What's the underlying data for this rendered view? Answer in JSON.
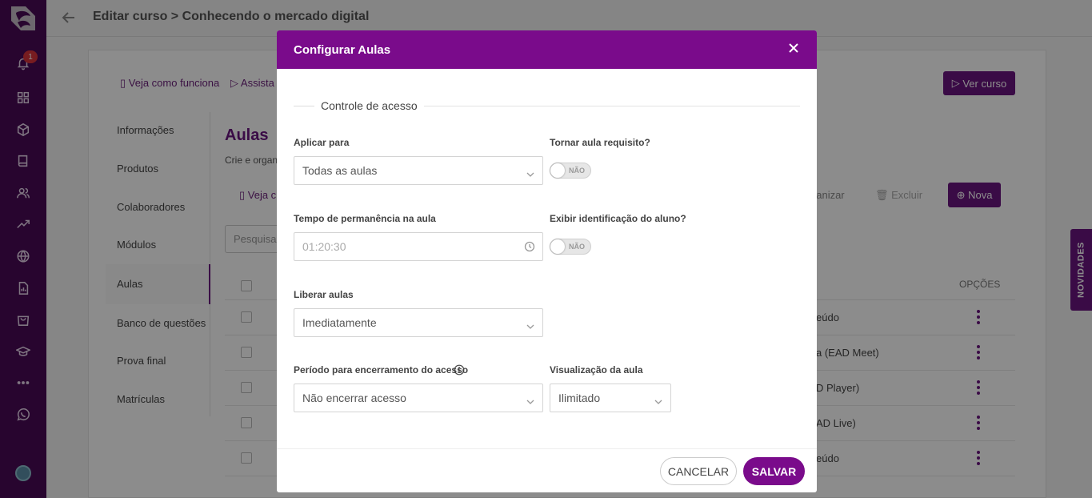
{
  "app": {
    "notification_count": "1"
  },
  "topbar": {
    "title": "Editar curso > Conhecendo o mercado digital"
  },
  "background": {
    "link_how_it_works": "Veja como funciona",
    "link_watch": "Assista",
    "ver_curso": "Ver curso",
    "subnav": [
      "Informações",
      "Produtos",
      "Colaboradores",
      "Módulos",
      "Aulas",
      "Banco de questões",
      "Prova final",
      "Matrículas"
    ],
    "aulas_title": "Aulas",
    "aulas_sub": "Crie e organ",
    "veja_link": "Veja c",
    "organizar": "ganizar",
    "excluir": "Excluir",
    "nova": "Nova",
    "search_placeholder": "Pesquisa",
    "opcoes": "OPÇÕES",
    "rows": [
      "eúdo",
      "a (EAD Meet)",
      "D Player)",
      "AD Live)",
      "eúdo"
    ],
    "novidades": "NOVIDADES"
  },
  "modal": {
    "title": "Configurar Aulas",
    "section": "Controle de acesso",
    "aplicar_para": {
      "label": "Aplicar para",
      "value": "Todas as aulas"
    },
    "tornar_requisito": {
      "label": "Tornar aula requisito?",
      "state": "NÃO"
    },
    "tempo_permanencia": {
      "label": "Tempo de permanência na aula",
      "placeholder": "01:20:30"
    },
    "exibir_identificacao": {
      "label": "Exibir identificação do aluno?",
      "state": "NÃO"
    },
    "liberar_aulas": {
      "label": "Liberar aulas",
      "value": "Imediatamente"
    },
    "periodo_encerramento": {
      "label": "Período para encerramento do acesso",
      "value": "Não encerrar acesso"
    },
    "visualizacao": {
      "label": "Visualização da aula",
      "value": "Ilimitado"
    },
    "cancel_label": "CANCELAR",
    "save_label": "SALVAR"
  },
  "colors": {
    "brand": "#7a0b8b",
    "sidebar": "#4a0a57"
  }
}
